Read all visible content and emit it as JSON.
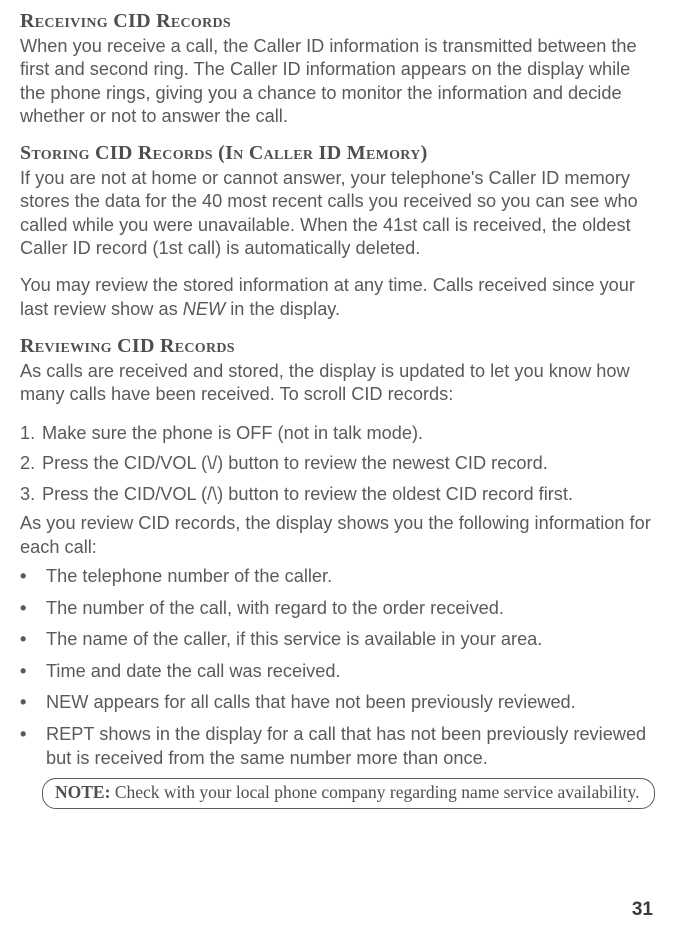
{
  "section1": {
    "heading": "Receiving CID Records",
    "p1": "When you receive a call, the Caller ID information is transmitted between the first and second ring. The Caller ID information appears on the display while the phone rings, giving you a chance to monitor the information and decide whether or not to answer the call."
  },
  "section2": {
    "heading": "Storing CID Records (In Caller ID Memory)",
    "p1": "If you are not at home or cannot answer, your telephone's Caller ID memory stores the data for the 40 most recent calls you received so you can see who called while you were unavailable. When the 41st call is received, the oldest Caller ID record (1st call) is automatically deleted.",
    "p2a": "You may review the stored information at any time. Calls received since your last review show as ",
    "p2_italic": "NEW",
    "p2b": " in the display."
  },
  "section3": {
    "heading": "Reviewing CID Records",
    "p1": "As calls are received and stored, the display is updated to let you know how many calls have been received. To scroll CID records:",
    "ol": [
      {
        "n": "1.",
        "t": "Make sure the phone is OFF (not in talk mode)."
      },
      {
        "n": "2.",
        "t": "Press the CID/VOL (\\/) button to review the newest CID record."
      },
      {
        "n": "3.",
        "t": "Press the CID/VOL (/\\) button to review the oldest CID record first."
      }
    ],
    "p2": "As you review CID records, the display shows you the following information for each call:",
    "ul": [
      "The telephone number of the caller.",
      "The number of the call, with regard to the order received.",
      "The name of the caller, if this service is available in your area.",
      "Time and date the call was received.",
      "NEW appears for all calls that have not been previously reviewed.",
      "REPT shows in the display for a call that has not been previously reviewed but is received from the same number more than once."
    ],
    "note_label": "NOTE:",
    "note_text": " Check with your local phone company regarding name service availability."
  },
  "page_number": "31"
}
